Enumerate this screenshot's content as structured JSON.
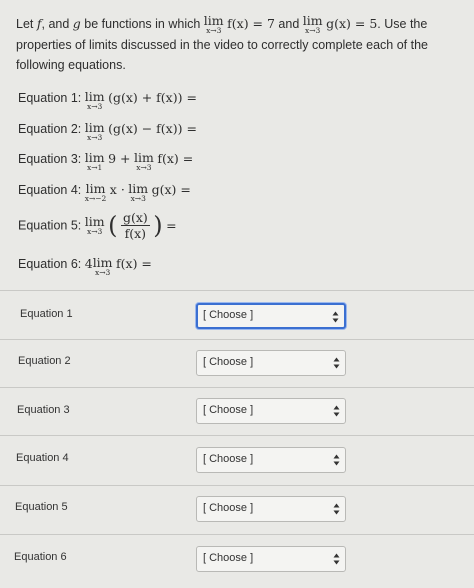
{
  "prompt": {
    "part1": "Let ",
    "f": "f",
    "part2": ", and ",
    "g": "g",
    "part3": " be functions in which ",
    "lim": "lim",
    "sub": "x→3",
    "fx": "f(x) = 7",
    "and": " and ",
    "gx": "g(x) = 5",
    "part4": ". Use the properties of limits discussed in the video to correctly complete each of the following equations."
  },
  "equations": [
    {
      "label": "Equation 1:",
      "parts": [
        "lim",
        "x→3",
        "(g(x) + f(x)) ="
      ]
    },
    {
      "label": "Equation 2:",
      "parts": [
        "lim",
        "x→3",
        "(g(x) − f(x)) ="
      ]
    },
    {
      "label": "Equation 3:",
      "parts": [
        "lim",
        "x→1",
        "9 +",
        "lim",
        "x→3",
        "f(x) ="
      ]
    },
    {
      "label": "Equation 4:",
      "parts": [
        "lim",
        "x→−2",
        "x ·",
        "lim",
        "x→3",
        "g(x) ="
      ]
    },
    {
      "label": "Equation 5:",
      "parts": [
        "lim",
        "x→3",
        "g(x)",
        "f(x)",
        "="
      ]
    },
    {
      "label": "Equation 6:",
      "parts": [
        "4",
        "lim",
        "x→3",
        "f(x) ="
      ]
    }
  ],
  "rows": [
    {
      "label": "Equation 1",
      "value": "[ Choose ]"
    },
    {
      "label": "Equation 2",
      "value": "[ Choose ]"
    },
    {
      "label": "Equation 3",
      "value": "[ Choose ]"
    },
    {
      "label": "Equation 4",
      "value": "[ Choose ]"
    },
    {
      "label": "Equation 5",
      "value": "[ Choose ]"
    },
    {
      "label": "Equation 6",
      "value": "[ Choose ]"
    }
  ]
}
